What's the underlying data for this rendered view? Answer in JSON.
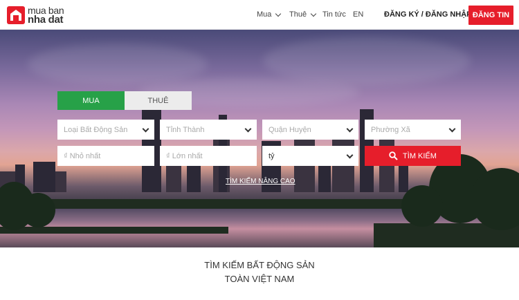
{
  "header": {
    "logo_line1": "mua ban",
    "logo_line2": "nha dat",
    "nav": {
      "buy": "Mua",
      "rent": "Thuê",
      "news": "Tin tức",
      "lang": "EN"
    },
    "auth": "ĐĂNG KÝ / ĐĂNG NHẬP",
    "post_button": "ĐĂNG TIN"
  },
  "search": {
    "tabs": [
      {
        "label": "MUA",
        "active": true
      },
      {
        "label": "THUÊ",
        "active": false
      }
    ],
    "property_type": "Loại Bất Động Sản",
    "province": "Tỉnh Thành",
    "district": "Quận Huyện",
    "ward": "Phường Xã",
    "min_price": "₫ Nhỏ nhất",
    "max_price": "₫ Lớn nhất",
    "unit": "tỷ",
    "search_button": "TÌM KIẾM",
    "advanced_link": "TÌM KIẾM NÂNG CAO"
  },
  "tagline": {
    "line1": "TÌM KIẾM BẤT ĐỘNG SẢN",
    "line2": "TOÀN VIỆT NAM"
  },
  "colors": {
    "brand_red": "#e61e2b",
    "tab_green": "#27a148"
  }
}
